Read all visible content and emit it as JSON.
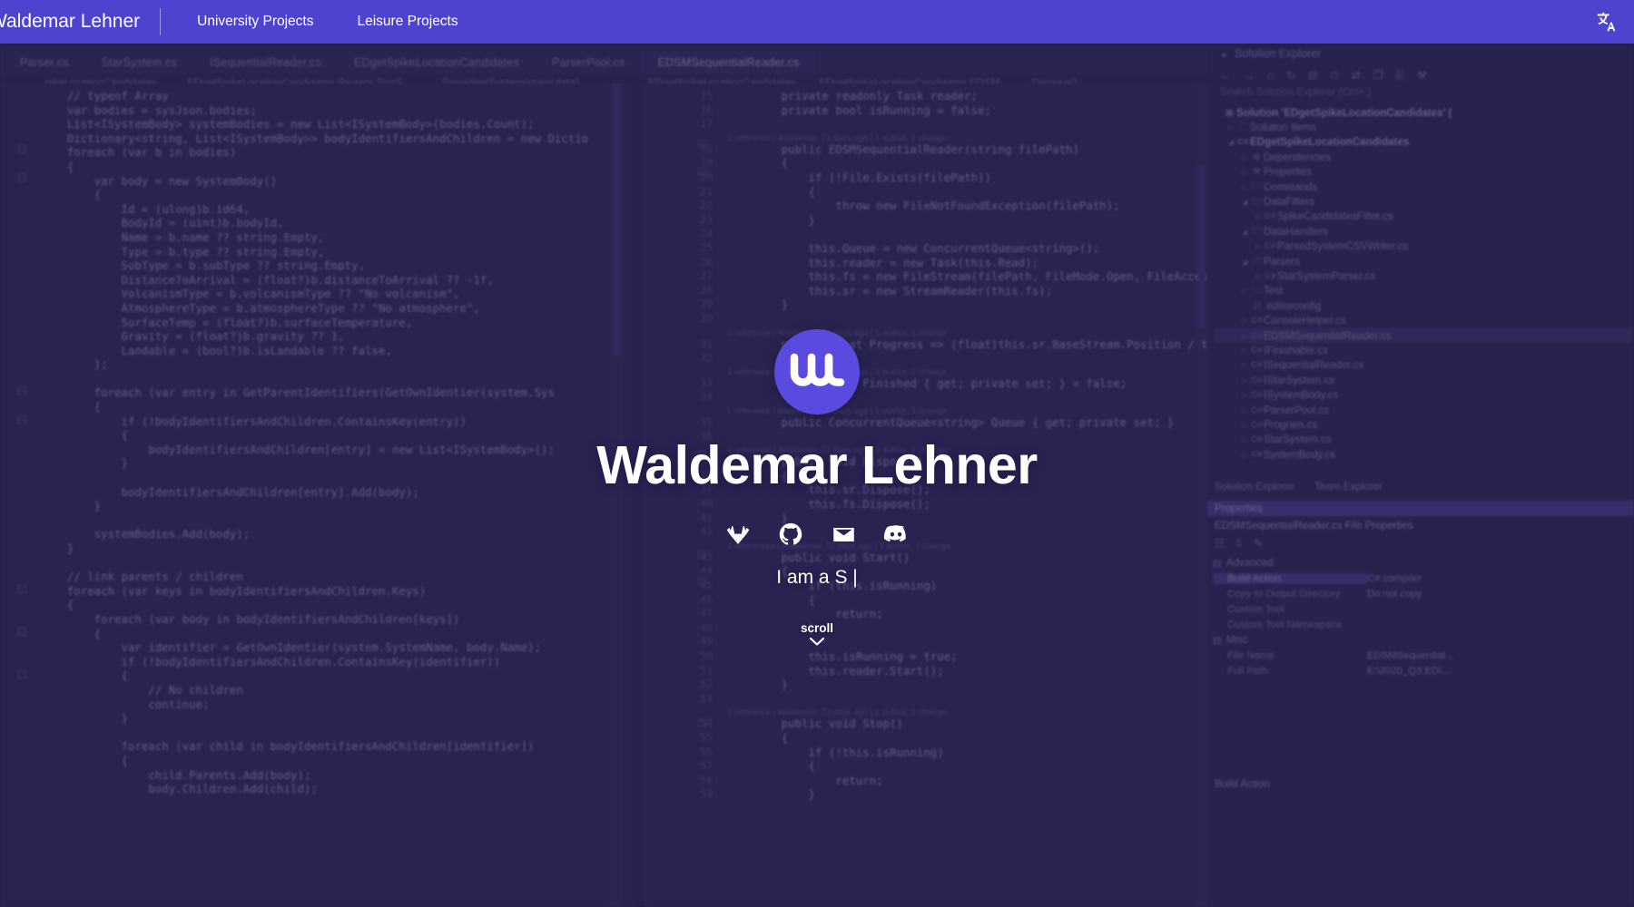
{
  "navbar": {
    "brand": "Waldemar Lehner",
    "links": [
      {
        "label": "University Projects"
      },
      {
        "label": "Leisure Projects"
      }
    ],
    "language_icon": "translate-icon",
    "background_color": "#4e43ce"
  },
  "hero": {
    "avatar_initials": "WL",
    "avatar_icon": "wl-monogram-logo",
    "name": "Waldemar Lehner",
    "typing_text": "I am a S ",
    "typing_caret": "|",
    "scroll_label": "scroll",
    "scroll_icon": "chevron-down-icon",
    "socials": [
      {
        "name": "gitlab-icon",
        "label": "GitLab"
      },
      {
        "name": "github-icon",
        "label": "GitHub"
      },
      {
        "name": "email-icon",
        "label": "Email"
      },
      {
        "name": "discord-icon",
        "label": "Discord"
      }
    ]
  },
  "background": {
    "app": "Visual Studio",
    "editor_tabs": [
      {
        "label": "Parser.cs",
        "active": false
      },
      {
        "label": "StarSystem.cs",
        "active": false
      },
      {
        "label": "ISequentialReader.cs",
        "active": false
      },
      {
        "label": "EDgetSpikeLocationCandidates",
        "active": false
      },
      {
        "label": "ParserPool.cs",
        "active": false
      },
      {
        "label": "EDSMSequentialReader.cs",
        "active": true
      }
    ],
    "breadcrumbs_left": [
      "...pikeLocationCandidates",
      "EDgetSpikeLocationCandidates.Parsers.StarS...",
      "ParseStarSystem(string data)"
    ],
    "breadcrumbs_right": [
      "EDgetSpikeLocationCandidates",
      "EDgetSpikeLocationCandidates.EDSM...",
      "Dispose()"
    ],
    "code_left": [
      "    // typeof Array",
      "    var bodies = sysJson.bodies;",
      "    List<ISystemBody> systemBodies = new List<ISystemBody>(bodies.Count);",
      "    Dictionary<string, List<ISystemBody>> bodyIdentifiersAndChildren = new Dictio",
      "    foreach (var b in bodies)",
      "    {",
      "        var body = new SystemBody()",
      "        {",
      "            Id = (ulong)b.id64,",
      "            BodyId = (uint)b.bodyId,",
      "            Name = b.name ?? string.Empty,",
      "            Type = b.type ?? string.Empty,",
      "            SubType = b.subType ?? string.Empty,",
      "            DistanceToArrival = (float?)b.distanceToArrival ?? -1f,",
      "            VolcanismType = b.volcanismType ?? \"No volcanism\",",
      "            AtmosphereType = b.atmosphereType ?? \"No atmosphere\",",
      "            SurfaceTemp = (float?)b.surfaceTemperature,",
      "            Gravity = (float?)b.gravity ?? 1,",
      "            Landable = (bool?)b.isLandable ?? false,",
      "        };",
      "",
      "        foreach (var entry in GetParentIdentifiers(GetOwnIdentier(system.Sys",
      "        {",
      "            if (!bodyIdentifiersAndChildren.ContainsKey(entry))",
      "            {",
      "                bodyIdentifiersAndChildren[entry] = new List<ISystemBody>();",
      "            }",
      "",
      "            bodyIdentifiersAndChildren[entry].Add(body);",
      "        }",
      "",
      "        systemBodies.Add(body);",
      "    }",
      "",
      "    // link parents / children",
      "    foreach (var keys in bodyIdentifiersAndChildren.Keys)",
      "    {",
      "        foreach (var body in bodyIdentifiersAndChildren[keys])",
      "        {",
      "            var identifier = GetOwnIdentier(system.SystemName, body.Name);",
      "            if (!bodyIdentifiersAndChildren.ContainsKey(identifier))",
      "            {",
      "                // No children",
      "                continue;",
      "            }",
      "",
      "            foreach (var child in bodyIdentifiersAndChildren[identifier])",
      "            {",
      "                child.Parents.Add(body);",
      "                body.Children.Add(child);"
    ],
    "code_right": [
      {
        "line": "15",
        "text": "        private readonly Task reader;"
      },
      {
        "line": "16",
        "text": "        private bool isRunning = false;"
      },
      {
        "line": "17",
        "text": ""
      },
      {
        "line": "",
        "text": "        1 reference | Waldemar, 72 days ago | 1 author, 1 change",
        "lens": true
      },
      {
        "line": "18",
        "text": "        public EDSMSequentialReader(string filePath)"
      },
      {
        "line": "19",
        "text": "        {"
      },
      {
        "line": "20",
        "text": "            if (!File.Exists(filePath))"
      },
      {
        "line": "21",
        "text": "            {"
      },
      {
        "line": "22",
        "text": "                throw new FileNotFoundException(filePath);"
      },
      {
        "line": "23",
        "text": "            }"
      },
      {
        "line": "24",
        "text": ""
      },
      {
        "line": "25",
        "text": "            this.Queue = new ConcurrentQueue<string>();"
      },
      {
        "line": "26",
        "text": "            this.reader = new Task(this.Read);"
      },
      {
        "line": "27",
        "text": "            this.fs = new FileStream(filePath, FileMode.Open, FileAccess.Read,"
      },
      {
        "line": "28",
        "text": "            this.sr = new StreamReader(this.fs);"
      },
      {
        "line": "29",
        "text": "        }"
      },
      {
        "line": "30",
        "text": ""
      },
      {
        "line": "",
        "text": "        1 reference | Waldemar, 72 days ago | 1 author, 1 change",
        "lens": true
      },
      {
        "line": "31",
        "text": "        public float Progress => (float)this.sr.BaseStream.Position / this.sr.B"
      },
      {
        "line": "32",
        "text": ""
      },
      {
        "line": "",
        "text": "        1 reference | Waldemar, 72 days ago | 1 author, 1 change",
        "lens": true
      },
      {
        "line": "33",
        "text": "        public bool Finished { get; private set; } = false;"
      },
      {
        "line": "34",
        "text": ""
      },
      {
        "line": "",
        "text": "        1 reference | Waldemar, 72 days ago | 1 author, 1 change",
        "lens": true
      },
      {
        "line": "35",
        "text": "        public ConcurrentQueue<string> Queue { get; private set; }"
      },
      {
        "line": "36",
        "text": ""
      },
      {
        "line": "",
        "text": "        1 reference | Waldemar, 72 days ago | 1 author, 1 change",
        "lens": true
      },
      {
        "line": "37",
        "text": "        public void Dispose()"
      },
      {
        "line": "38",
        "text": "        {"
      },
      {
        "line": "39",
        "text": "            this.sr.Dispose();"
      },
      {
        "line": "40",
        "text": "            this.fs.Dispose();"
      },
      {
        "line": "41",
        "text": "        }"
      },
      {
        "line": "42",
        "text": ""
      },
      {
        "line": "",
        "text": "        2 references | Waldemar, 72 days ago | 1 author, 1 change",
        "lens": true
      },
      {
        "line": "43",
        "text": "        public void Start()"
      },
      {
        "line": "44",
        "text": "        {"
      },
      {
        "line": "45",
        "text": "            if (this.isRunning)"
      },
      {
        "line": "46",
        "text": "            {"
      },
      {
        "line": "47",
        "text": "                return;"
      },
      {
        "line": "48",
        "text": "            }"
      },
      {
        "line": "49",
        "text": ""
      },
      {
        "line": "50",
        "text": "            this.isRunning = true;"
      },
      {
        "line": "51",
        "text": "            this.reader.Start();"
      },
      {
        "line": "52",
        "text": "        }"
      },
      {
        "line": "53",
        "text": ""
      },
      {
        "line": "",
        "text": "        1 reference | Waldemar, 72 days ago | 1 author, 1 change",
        "lens": true
      },
      {
        "line": "54",
        "text": "        public void Stop()"
      },
      {
        "line": "55",
        "text": "        {"
      },
      {
        "line": "56",
        "text": "            if (!this.isRunning)"
      },
      {
        "line": "57",
        "text": "            {"
      },
      {
        "line": "58",
        "text": "                return;"
      },
      {
        "line": "59",
        "text": "            }"
      }
    ],
    "solution_explorer": {
      "title": "Solution Explorer",
      "search_placeholder": "Search Solution Explorer (Ctrl+;)",
      "toolbar_icons": [
        "back-icon",
        "forward-icon",
        "home-icon",
        "refresh-icon",
        "collapse-icon",
        "pending-changes-icon",
        "sync-icon",
        "show-all-files-icon",
        "properties-icon",
        "wrench-icon"
      ],
      "tree": [
        {
          "indent": 0,
          "twisty": "",
          "icon": "solution-icon",
          "label": "Solution 'EDgetSpikeLocationCandidates' (",
          "bold": true
        },
        {
          "indent": 1,
          "twisty": "▷",
          "icon": "folder-icon",
          "label": "Solution Items",
          "bold": false
        },
        {
          "indent": 1,
          "twisty": "◢",
          "icon": "csproj-icon",
          "label": "EDgetSpikeLocationCandidates",
          "bold": true
        },
        {
          "indent": 2,
          "twisty": "▷",
          "icon": "dependencies-icon",
          "label": "Dependencies",
          "bold": false
        },
        {
          "indent": 2,
          "twisty": "▷",
          "icon": "wrench-icon",
          "label": "Properties",
          "bold": false
        },
        {
          "indent": 2,
          "twisty": "▷",
          "icon": "folder-icon",
          "label": "Commands",
          "bold": false
        },
        {
          "indent": 2,
          "twisty": "◢",
          "icon": "folder-open-icon",
          "label": "DataFilters",
          "bold": false
        },
        {
          "indent": 3,
          "twisty": "▷",
          "icon": "cs-file-icon",
          "label": "SpikeCandidatesFilter.cs",
          "bold": false
        },
        {
          "indent": 2,
          "twisty": "◢",
          "icon": "folder-open-icon",
          "label": "DataHandlers",
          "bold": false
        },
        {
          "indent": 3,
          "twisty": "▷",
          "icon": "cs-file-icon",
          "label": "ParsedSystemCSVWriter.cs",
          "bold": false
        },
        {
          "indent": 2,
          "twisty": "◢",
          "icon": "folder-open-icon",
          "label": "Parsers",
          "bold": false
        },
        {
          "indent": 3,
          "twisty": "▷",
          "icon": "cs-file-icon",
          "label": "StarSystemParser.cs",
          "bold": false
        },
        {
          "indent": 2,
          "twisty": "▷",
          "icon": "folder-icon",
          "label": "Test",
          "bold": false
        },
        {
          "indent": 2,
          "twisty": "",
          "icon": "config-file-icon",
          "label": ".editorconfig",
          "bold": false
        },
        {
          "indent": 2,
          "twisty": "▷",
          "icon": "cs-file-icon",
          "label": "ConsoleHelper.cs",
          "bold": false
        },
        {
          "indent": 2,
          "twisty": "▷",
          "icon": "cs-file-icon",
          "label": "EDSMSequentialReader.cs",
          "bold": false,
          "selected": true
        },
        {
          "indent": 2,
          "twisty": "▷",
          "icon": "cs-file-icon",
          "label": "IFinishable.cs",
          "bold": false
        },
        {
          "indent": 2,
          "twisty": "▷",
          "icon": "cs-file-icon",
          "label": "ISequentialReader.cs",
          "bold": false
        },
        {
          "indent": 2,
          "twisty": "▷",
          "icon": "cs-file-icon",
          "label": "IStarSystem.cs",
          "bold": false
        },
        {
          "indent": 2,
          "twisty": "▷",
          "icon": "cs-file-icon",
          "label": "ISystemBody.cs",
          "bold": false
        },
        {
          "indent": 2,
          "twisty": "▷",
          "icon": "cs-file-icon",
          "label": "ParserPool.cs",
          "bold": false
        },
        {
          "indent": 2,
          "twisty": "▷",
          "icon": "cs-file-icon",
          "label": "Program.cs",
          "bold": false
        },
        {
          "indent": 2,
          "twisty": "▷",
          "icon": "cs-file-icon",
          "label": "StarSystem.cs",
          "bold": false
        },
        {
          "indent": 2,
          "twisty": "▷",
          "icon": "cs-file-icon",
          "label": "SystemBody.cs",
          "bold": false
        }
      ],
      "bottom_tabs": [
        {
          "label": "Solution Explorer"
        },
        {
          "label": "Team Explorer"
        }
      ]
    },
    "properties_panel": {
      "title": "Properties",
      "subtitle": "EDSMSequentialReader.cs  File Properties",
      "toolbar_icons": [
        "categorized-icon",
        "alphabetical-icon",
        "properties-page-icon"
      ],
      "categories": [
        {
          "name": "Advanced",
          "rows": [
            {
              "key": "Build Action",
              "value": "C# compiler",
              "highlight": true
            },
            {
              "key": "Copy to Output Directory",
              "value": "Do not copy",
              "highlight": false
            },
            {
              "key": "Custom Tool",
              "value": "",
              "highlight": false
            },
            {
              "key": "Custom Tool Namespace",
              "value": "",
              "highlight": false
            }
          ]
        },
        {
          "name": "Misc",
          "rows": [
            {
              "key": "File Name",
              "value": "EDSMSequential...",
              "highlight": false
            },
            {
              "key": "Full Path",
              "value": "E:\\2020_Q3 ED\\...",
              "highlight": false
            }
          ]
        }
      ],
      "footer": "Build Action"
    }
  }
}
